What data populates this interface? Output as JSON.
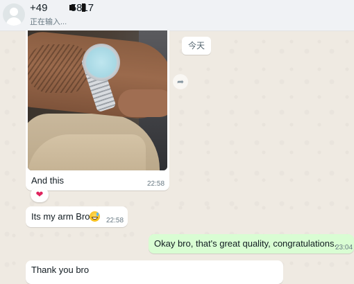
{
  "header": {
    "contact_name": "+49        5817",
    "status": "正在输入..."
  },
  "messages": {
    "photo_caption": "And this",
    "photo_time": "22:58",
    "reaction": "❤",
    "date_chip": "今天",
    "arm_text": "Its my arm Bro",
    "arm_time": "22:58",
    "reply_text": "Okay bro, that's great quality, congratulations.",
    "reply_time": "23:04",
    "thanks_text": "Thank you bro"
  },
  "icons": {
    "forward": "forward-arrow-icon",
    "avatar": "default-avatar-icon",
    "emoji": "grinning-sweat-emoji"
  },
  "colors": {
    "chat_bg": "#efeae2",
    "incoming_bubble": "#ffffff",
    "outgoing_bubble": "#d9fdd3",
    "header_bg": "#f0f2f5"
  }
}
